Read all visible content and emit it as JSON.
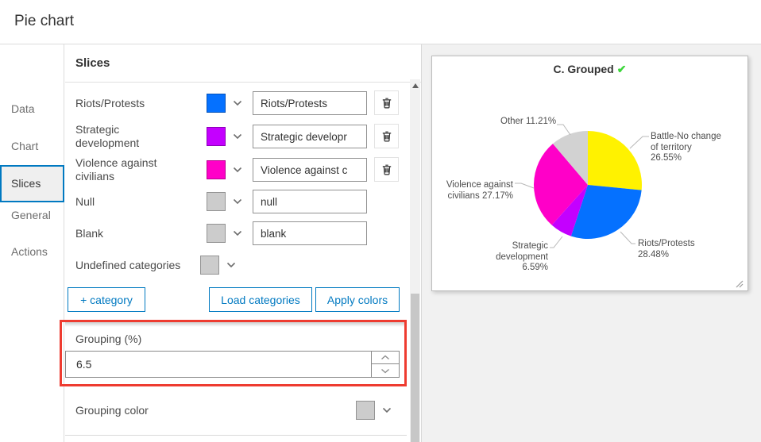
{
  "window": {
    "title": "Pie chart"
  },
  "sidebar": {
    "items": [
      {
        "label": "Data"
      },
      {
        "label": "Chart"
      },
      {
        "label": "Slices",
        "selected": true
      },
      {
        "label": "General"
      },
      {
        "label": "Actions"
      }
    ]
  },
  "panel": {
    "title": "Slices",
    "accent_color": "#0079C1",
    "highlight_color": "#EE3B30",
    "rows": [
      {
        "label": "Riots/Protests",
        "color": "#0571FF",
        "value": "Riots/Protests",
        "deletable": true
      },
      {
        "label": "Strategic development",
        "color": "#C400FF",
        "value": "Strategic developr",
        "deletable": true
      },
      {
        "label": "Violence against civilians",
        "color": "#FF00C8",
        "value": "Violence against c",
        "deletable": true
      },
      {
        "label": "Null",
        "color": "#CCCCCC",
        "value": "null",
        "deletable": false
      },
      {
        "label": "Blank",
        "color": "#CCCCCC",
        "value": "blank",
        "deletable": false
      },
      {
        "label": "Undefined categories",
        "color": "#CCCCCC",
        "value": null,
        "deletable": false
      }
    ],
    "buttons": {
      "add_category": "+ category",
      "load_categories": "Load categories",
      "apply_colors": "Apply colors"
    },
    "grouping": {
      "label": "Grouping (%)",
      "value": "6.5"
    },
    "grouping_color": {
      "label": "Grouping color",
      "color": "#CCCCCC"
    }
  },
  "chart_data": {
    "type": "pie",
    "title": "C. Grouped",
    "title_check": "✔",
    "check_color": "#3BD639",
    "start_angle_deg": 0,
    "direction": "clockwise",
    "legend": "none",
    "label_position": "outside",
    "series": [
      {
        "name": "Battle-No change of territory",
        "value": 26.55,
        "color": "#FFF200"
      },
      {
        "name": "Riots/Protests",
        "value": 28.48,
        "color": "#0571FF"
      },
      {
        "name": "Strategic development",
        "value": 6.59,
        "color": "#C400FF"
      },
      {
        "name": "Violence against civilians",
        "value": 27.17,
        "color": "#FF00C8"
      },
      {
        "name": "Other (grouped)",
        "value": 11.21,
        "color": "#D2D2D2"
      }
    ],
    "labels": {
      "other": "Other 11.21%",
      "battle": "Battle-No change\nof territory\n26.55%",
      "riots": "Riots/Protests\n28.48%",
      "strategic": "Strategic\ndevelopment\n6.59%",
      "violence": "Violence against\ncivilians 27.17%"
    }
  }
}
